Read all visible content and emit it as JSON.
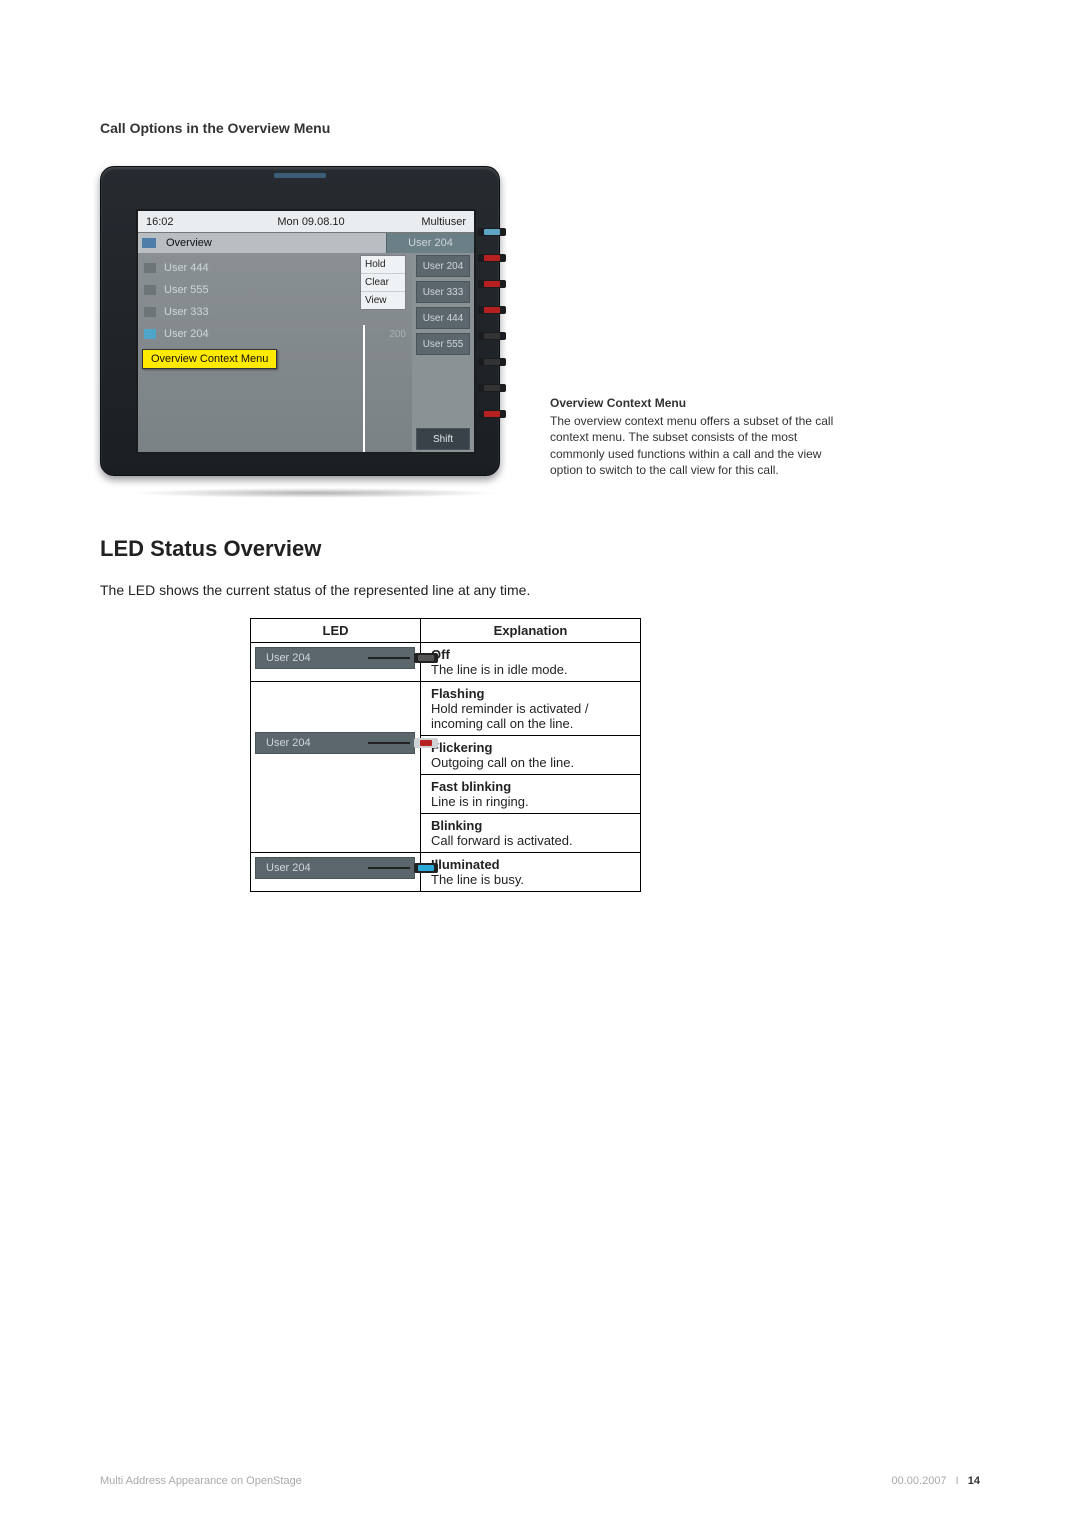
{
  "figure_title": "Call Options in the Overview Menu",
  "phone": {
    "time": "16:02",
    "date": "Mon 09.08.10",
    "mode": "Multiuser",
    "overview_label": "Overview",
    "tab_label": "User 204",
    "rows": [
      {
        "label": "User 444",
        "num": "",
        "accent": false
      },
      {
        "label": "User 555",
        "num": "",
        "accent": false
      },
      {
        "label": "User 333",
        "num": "",
        "accent": false
      },
      {
        "label": "User 204",
        "num": "200",
        "accent": true
      }
    ],
    "context_menu": [
      "Hold",
      "Clear",
      "View"
    ],
    "line_keys": [
      "User 204",
      "User 333",
      "User 444",
      "User 555"
    ],
    "shift_label": "Shift"
  },
  "annotation": {
    "label": "Overview Context Menu",
    "title": "Overview Context Menu",
    "body": "The overview context menu offers a subset of the call context menu. The subset consists of the most commonly used functions within a call and the view option to switch to the call view for this call."
  },
  "section": {
    "heading": "LED Status Overview",
    "lead": "The LED shows the current status of the represented line at any time."
  },
  "table": {
    "head_led": "LED",
    "head_exp": "Explanation",
    "cell_label": "User 204",
    "rows": [
      {
        "state": "Off",
        "desc": "The line is in idle mode."
      },
      {
        "state": "Flashing",
        "desc": "Hold reminder is activated / incoming call on the line."
      },
      {
        "state": "Flickering",
        "desc": "Outgoing call on the line."
      },
      {
        "state": "Fast blinking",
        "desc": "Line is in ringing."
      },
      {
        "state": "Blinking",
        "desc": "Call forward is activated."
      },
      {
        "state": "Illuminated",
        "desc": "The line is busy."
      }
    ]
  },
  "footer": {
    "left": "Multi Address Appearance on OpenStage",
    "date": "00.00.2007",
    "page": "14"
  }
}
